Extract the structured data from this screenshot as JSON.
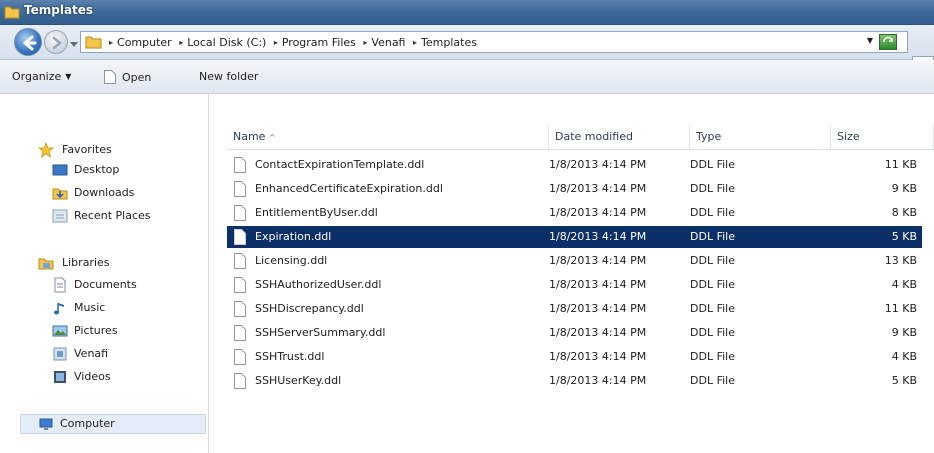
{
  "window": {
    "title": "Templates"
  },
  "address": {
    "crumbs": [
      "Computer",
      "Local Disk (C:)",
      "Program Files",
      "Venafi",
      "Templates"
    ]
  },
  "toolbar": {
    "organize": "Organize",
    "open": "Open",
    "new_folder": "New folder"
  },
  "nav": {
    "favorites": {
      "label": "Favorites",
      "items": [
        "Desktop",
        "Downloads",
        "Recent Places"
      ]
    },
    "libraries": {
      "label": "Libraries",
      "items": [
        "Documents",
        "Music",
        "Pictures",
        "Venafi",
        "Videos"
      ]
    },
    "computer": "Computer"
  },
  "list": {
    "columns": {
      "name": "Name",
      "sort_indicator": "^",
      "date": "Date modified",
      "type": "Type",
      "size": "Size"
    },
    "rows": [
      {
        "name": "ContactExpirationTemplate.ddl",
        "date": "1/8/2013 4:14 PM",
        "type": "DDL File",
        "size": "11 KB"
      },
      {
        "name": "EnhancedCertificateExpiration.ddl",
        "date": "1/8/2013 4:14 PM",
        "type": "DDL File",
        "size": "9 KB"
      },
      {
        "name": "EntitlementByUser.ddl",
        "date": "1/8/2013 4:14 PM",
        "type": "DDL File",
        "size": "8 KB"
      },
      {
        "name": "Expiration.ddl",
        "date": "1/8/2013 4:14 PM",
        "type": "DDL File",
        "size": "5 KB"
      },
      {
        "name": "Licensing.ddl",
        "date": "1/8/2013 4:14 PM",
        "type": "DDL File",
        "size": "13 KB"
      },
      {
        "name": "SSHAuthorizedUser.ddl",
        "date": "1/8/2013 4:14 PM",
        "type": "DDL File",
        "size": "4 KB"
      },
      {
        "name": "SSHDiscrepancy.ddl",
        "date": "1/8/2013 4:14 PM",
        "type": "DDL File",
        "size": "11 KB"
      },
      {
        "name": "SSHServerSummary.ddl",
        "date": "1/8/2013 4:14 PM",
        "type": "DDL File",
        "size": "9 KB"
      },
      {
        "name": "SSHTrust.ddl",
        "date": "1/8/2013 4:14 PM",
        "type": "DDL File",
        "size": "4 KB"
      },
      {
        "name": "SSHUserKey.ddl",
        "date": "1/8/2013 4:14 PM",
        "type": "DDL File",
        "size": "5 KB"
      }
    ]
  },
  "colors": {
    "selection": "#0c2f67",
    "titlebar": "#3f6a99"
  }
}
